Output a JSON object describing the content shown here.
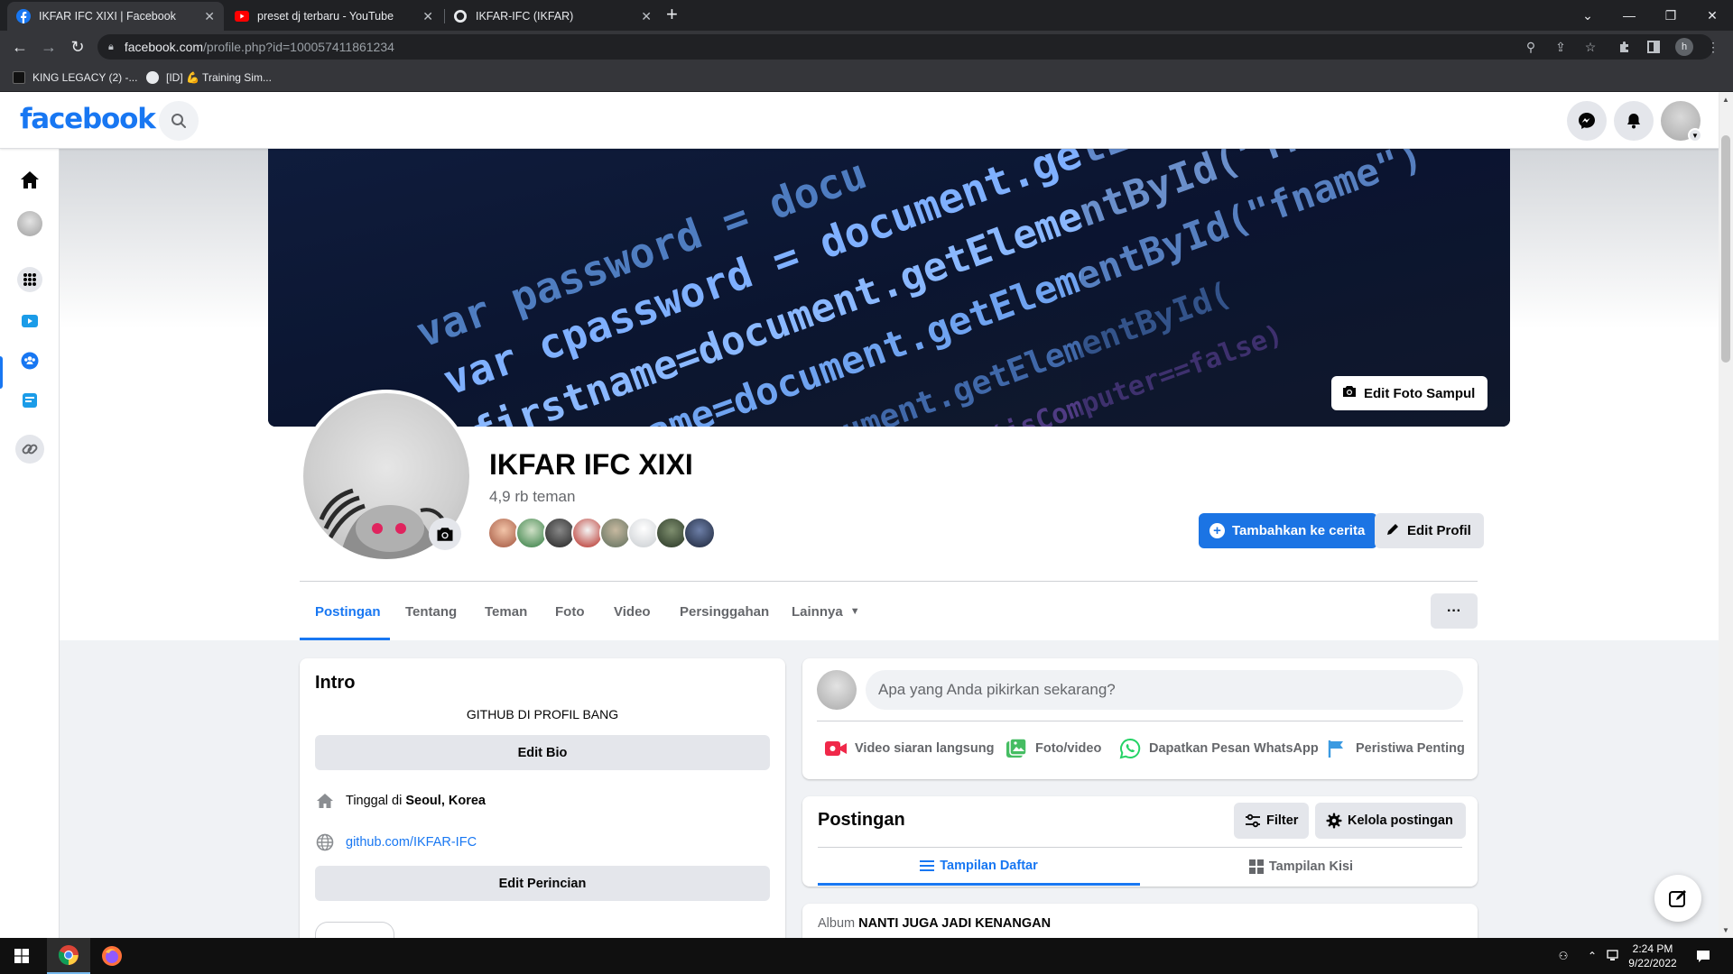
{
  "browser": {
    "tabs": [
      {
        "title": "IKFAR IFC XIXI | Facebook",
        "favicon": "facebook-icon",
        "active": true
      },
      {
        "title": "preset dj terbaru - YouTube",
        "favicon": "youtube-icon",
        "active": false
      },
      {
        "title": "IKFAR-IFC (IKFAR)",
        "favicon": "github-icon",
        "active": false
      }
    ],
    "url_host": "facebook.com",
    "url_path": "/profile.php?id=100057411861234",
    "profile_initial": "h",
    "bookmarks": [
      {
        "label": "KING LEGACY (2) -...",
        "icon": "roblox-icon"
      },
      {
        "label": "[ID] 💪 Training Sim...",
        "icon": "globe-icon"
      }
    ]
  },
  "facebook": {
    "logo": "facebook",
    "colors": {
      "brand": "#1877f2",
      "bg": "#f0f2f5",
      "text_secondary": "#65676b"
    },
    "cover": {
      "code_lines": [
        "var password = docu",
        "var cpassword = document.getElem",
        "firstname=document.getElementById(\"fname\")",
        "firstname=document.getElementById(\"fname\")",
        "document.getElementById(",
        "if(isComputer==false)"
      ],
      "edit_label": "Edit Foto Sampul"
    },
    "profile": {
      "name": "IKFAR IFC XIXI",
      "friends_count": "4,9 rb teman",
      "add_story_label": "Tambahkan ke cerita",
      "edit_profile_label": "Edit Profil"
    },
    "tabs": [
      "Postingan",
      "Tentang",
      "Teman",
      "Foto",
      "Video",
      "Persinggahan",
      "Lainnya"
    ],
    "more_label": "···",
    "intro": {
      "title": "Intro",
      "bio": "GITHUB DI PROFIL BANG",
      "edit_bio": "Edit Bio",
      "lives_prefix": "Tinggal di",
      "lives_place": "Seoul, Korea",
      "link": "github.com/IKFAR-IFC",
      "edit_details": "Edit Perincian"
    },
    "composer": {
      "placeholder": "Apa yang Anda pikirkan sekarang?",
      "actions": [
        "Video siaran langsung",
        "Foto/video",
        "Dapatkan Pesan WhatsApp",
        "Peristiwa Penting"
      ]
    },
    "posts": {
      "title": "Postingan",
      "filter": "Filter",
      "manage": "Kelola postingan",
      "view_list": "Tampilan Daftar",
      "view_grid": "Tampilan Kisi",
      "album_prefix": "Album",
      "album_name": "NANTI JUGA JADI KENANGAN"
    }
  },
  "taskbar": {
    "time": "2:24 PM",
    "date": "9/22/2022"
  }
}
